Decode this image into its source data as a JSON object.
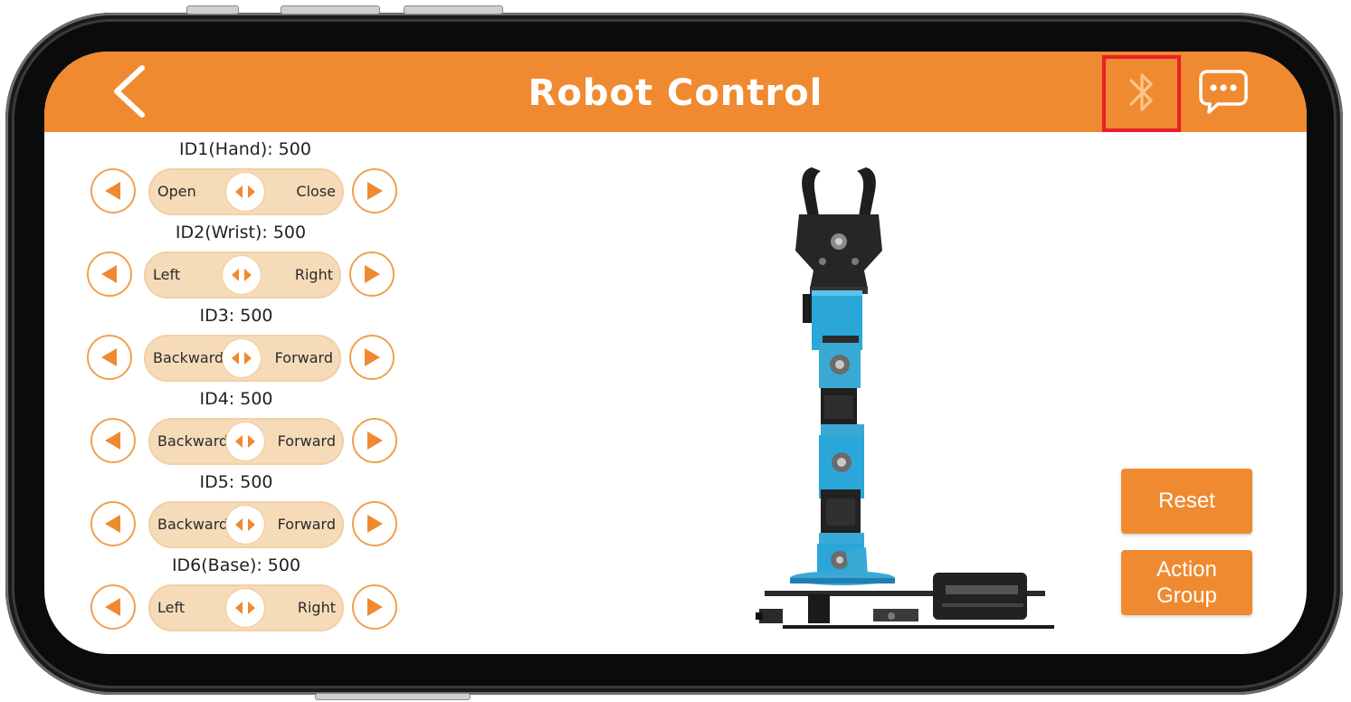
{
  "app": {
    "title": "Robot Control",
    "accent_color": "#f08a30",
    "highlight_color": "#e8202a"
  },
  "header": {
    "back_icon": "chevron-left-icon",
    "bluetooth_icon": "bluetooth-icon",
    "message_icon": "chat-bubble-icon"
  },
  "servos": [
    {
      "label": "ID1(Hand):  500",
      "left": "Open",
      "right": "Close"
    },
    {
      "label": "ID2(Wrist):  500",
      "left": "Left",
      "right": "Right"
    },
    {
      "label": "ID3:  500",
      "left": "Backward",
      "right": "Forward"
    },
    {
      "label": "ID4:  500",
      "left": "Backward",
      "right": "Forward"
    },
    {
      "label": "ID5:  500",
      "left": "Backward",
      "right": "Forward"
    },
    {
      "label": "ID6(Base):  500",
      "left": "Left",
      "right": "Right"
    }
  ],
  "buttons": {
    "reset": "Reset",
    "action_line1": "Action",
    "action_line2": "Group"
  }
}
